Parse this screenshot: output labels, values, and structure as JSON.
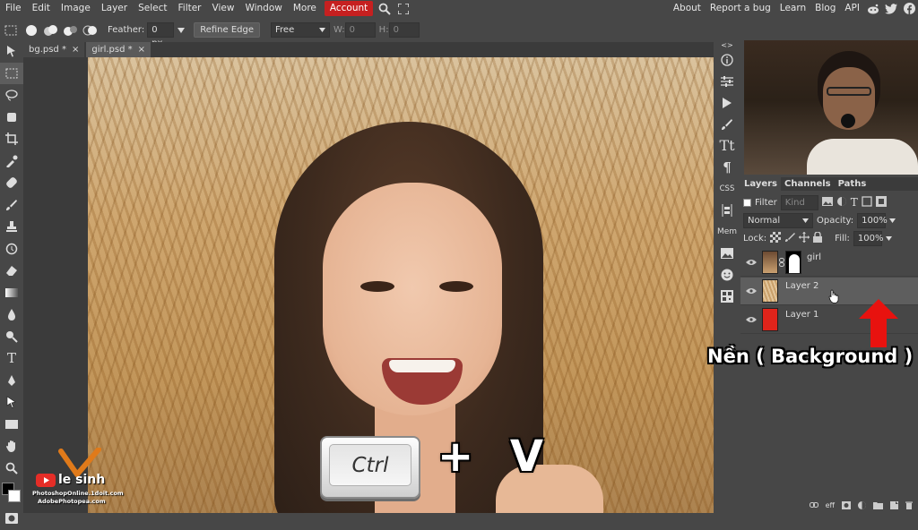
{
  "menubar": {
    "items": [
      "File",
      "Edit",
      "Image",
      "Layer",
      "Select",
      "Filter",
      "View",
      "Window",
      "More"
    ],
    "active": "Account",
    "right": [
      "About",
      "Report a bug",
      "Learn",
      "Blog",
      "API"
    ]
  },
  "options": {
    "feather_label": "Feather:",
    "feather_value": "0 px",
    "refine_edge": "Refine Edge",
    "style_value": "Free",
    "w_label": "W:",
    "w_value": "0",
    "h_label": "H:",
    "h_value": "0"
  },
  "tabs": [
    {
      "label": "bg.psd *"
    },
    {
      "label": "girl.psd *"
    }
  ],
  "tab_close": "×",
  "iconcol": {
    "css": "CSS",
    "mem": "Mem"
  },
  "panel": {
    "tabs": [
      "Layers",
      "Channels",
      "Paths"
    ],
    "filter_label": "Filter",
    "kind_value": "Kind",
    "blend_mode": "Normal",
    "opacity_label": "Opacity:",
    "opacity_value": "100%",
    "lock_label": "Lock:",
    "fill_label": "Fill:",
    "fill_value": "100%",
    "layers": [
      {
        "name": "girl"
      },
      {
        "name": "Layer 2"
      },
      {
        "name": "Layer 1"
      }
    ],
    "bottom_icons": [
      "eff"
    ]
  },
  "overlay": {
    "ctrl_key": "Ctrl",
    "plus_v": "+ V",
    "annotation": "Nền ( Background )"
  },
  "watermark": {
    "brand": "le sinh",
    "line1": "PhotoshopOnline.1doit.com",
    "line2": "AdobePhotopea.com"
  },
  "colors": {
    "account_bg": "#c62020",
    "layer1_fill": "#e0241b",
    "arrow": "#e8120f",
    "fg_color": "#000000",
    "bg_color": "#ffffff"
  }
}
